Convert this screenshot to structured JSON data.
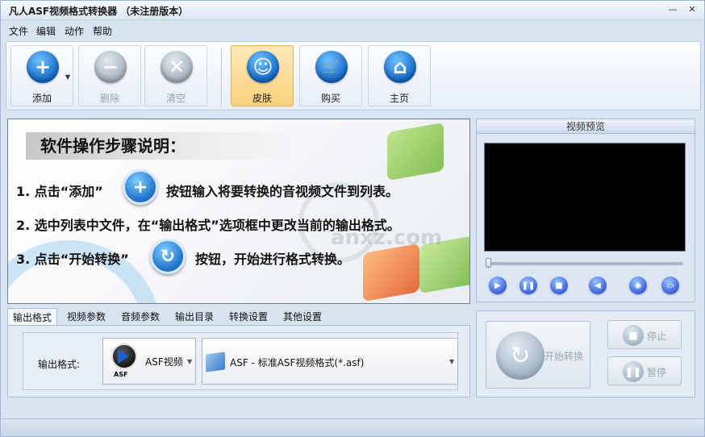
{
  "window": {
    "title": "凡人ASF视频格式转换器 （未注册版本）",
    "min_label": "—",
    "close_label": "✕"
  },
  "menu": [
    "文件",
    "编辑",
    "动作",
    "帮助"
  ],
  "toolbar": {
    "add": {
      "label": "添加",
      "icon": "+",
      "enabled": true
    },
    "delete": {
      "label": "删除",
      "icon": "−",
      "enabled": false
    },
    "clear": {
      "label": "清空",
      "icon": "✕",
      "enabled": false
    },
    "skin": {
      "label": "皮肤",
      "icon": "☺",
      "active": true
    },
    "buy": {
      "label": "购买",
      "icon": "🛒"
    },
    "home": {
      "label": "主页",
      "icon": "⌂"
    }
  },
  "instructions": {
    "title": "软件操作步骤说明：",
    "step1_pre": "1. 点击“添加”",
    "step1_post": "按钮输入将要转换的音视频文件到列表。",
    "step2": "2. 选中列表中文件，在“输出格式”选项框中更改当前的输出格式。",
    "step3_pre": "3. 点击“开始转换”",
    "step3_post": "按钮，开始进行格式转换。",
    "step1_icon": "+",
    "step3_icon": "↻"
  },
  "preview": {
    "title": "视频预览",
    "controls": [
      "play-icon",
      "pause-icon",
      "stop-icon",
      "volume-icon",
      "snapshot-icon",
      "folder-icon"
    ],
    "control_glyphs": [
      "▶",
      "❚❚",
      "■",
      "◀",
      "◉",
      "▭"
    ]
  },
  "tabs": [
    "输出格式",
    "视频参数",
    "音频参数",
    "输出目录",
    "转换设置",
    "其他设置"
  ],
  "active_tab": "输出格式",
  "output": {
    "label": "输出格式:",
    "format_name": "ASF视频",
    "format_tag": "ASF",
    "profile": "ASF - 标准ASF视频格式(*.asf)"
  },
  "convert": {
    "start_label": "开始转换",
    "stop_label": "停止",
    "pause_label": "暂停",
    "start_icon": "↻",
    "stop_icon": "■",
    "pause_icon": "❚❚"
  },
  "watermark": {
    "text": "anxz.com"
  }
}
